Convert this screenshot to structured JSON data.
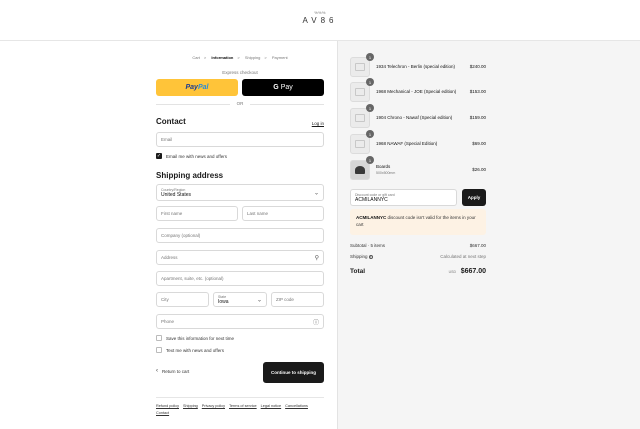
{
  "brand": {
    "mark": "%%%",
    "name": "AV86"
  },
  "breadcrumb": [
    "Cart",
    "Information",
    "Shipping",
    "Payment"
  ],
  "breadcrumb_sep": ">",
  "express_checkout": "Express checkout",
  "paypal": {
    "pay": "Pay",
    "pal": "Pal"
  },
  "gpay": {
    "g": "G",
    "label": "Pay"
  },
  "or_text": "OR",
  "contact": {
    "title": "Contact",
    "login": "Log in",
    "email_placeholder": "Email",
    "newsletter_label": "Email me with news and offers",
    "newsletter_checked": true
  },
  "shipping": {
    "title": "Shipping address",
    "country_label": "Country/Region",
    "country_value": "United States",
    "first_name": "First name",
    "last_name": "Last name",
    "company": "Company (optional)",
    "address": "Address",
    "apartment": "Apartment, suite, etc. (optional)",
    "city": "City",
    "state_label": "State",
    "state_value": "Iowa",
    "zip": "ZIP code",
    "phone": "Phone",
    "save_info": "Save this information for next time",
    "text_me": "Text me with news and offers"
  },
  "actions": {
    "return": "Return to cart",
    "continue": "Continue to shipping"
  },
  "footer_links": [
    "Refund policy",
    "Shipping",
    "Privacy policy",
    "Terms of service",
    "Legal notice",
    "Cancellations",
    "Contact"
  ],
  "order": {
    "items": [
      {
        "qty": "1",
        "name": "1934 Telechron - Berlin (special edition)",
        "price": "$240.00",
        "sub": ""
      },
      {
        "qty": "1",
        "name": "1968 Mechanical - JOE (Special edition)",
        "price": "$153.00",
        "sub": ""
      },
      {
        "qty": "1",
        "name": "1904 Chrono - Nawaf (Special edition)",
        "price": "$159.00",
        "sub": ""
      },
      {
        "qty": "1",
        "name": "1968 NAWAF (Special Edition)",
        "price": "$69.00",
        "sub": ""
      },
      {
        "qty": "1",
        "name": "Boards",
        "price": "$26.00",
        "sub": "500x500mm"
      }
    ],
    "discount_label": "Discount code or gift card",
    "discount_value": "ACMILANNYC",
    "apply": "Apply",
    "alert_code": "ACMILANNYC",
    "alert_text": " discount code isn't valid for the items in your cart",
    "subtotal_label": "Subtotal · 5 items",
    "subtotal_value": "$667.00",
    "shipping_label": "Shipping",
    "shipping_value": "Calculated at next step",
    "total_label": "Total",
    "currency": "USD",
    "total_value": "$667.00"
  }
}
